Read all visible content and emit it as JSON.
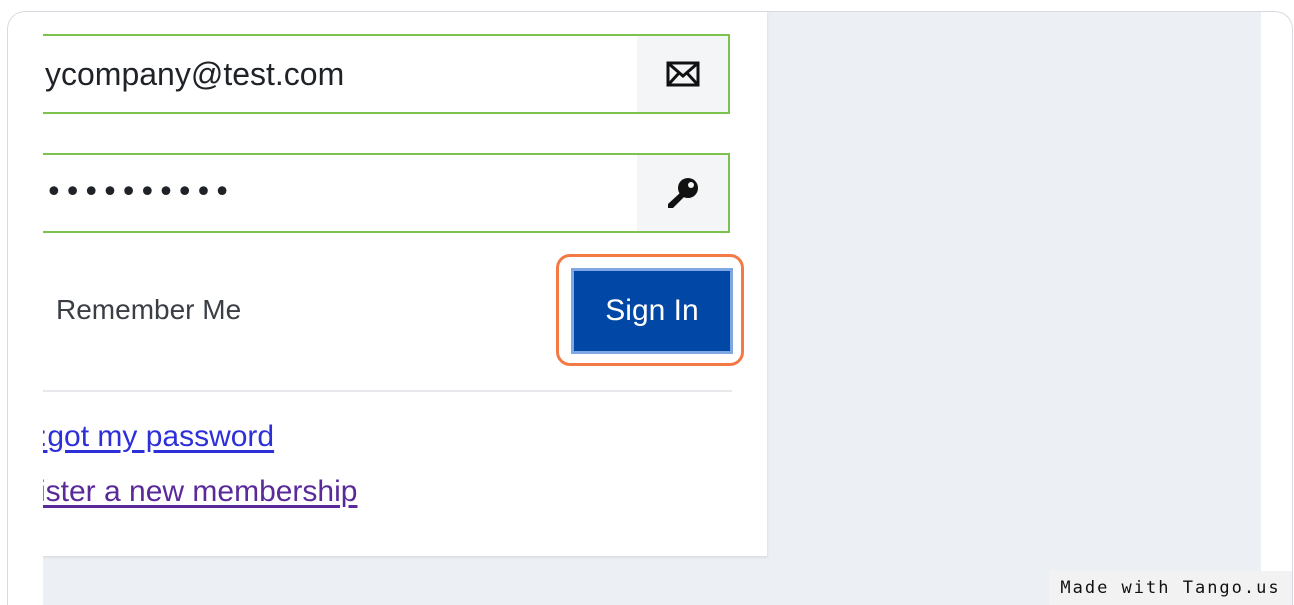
{
  "login": {
    "email_value": "ycompany@test.com",
    "email_icon": "envelope-icon",
    "password_value": "••••••••••",
    "password_icon": "key-icon",
    "remember_label": "Remember Me",
    "signin_label": "Sign In",
    "forgot_link": ":got my password",
    "register_link": "ister a new membership"
  },
  "highlight_color": "#f47a45",
  "button_color": "#0047a6",
  "field_border_color": "#7cc24e",
  "watermark": "Made with Tango.us"
}
